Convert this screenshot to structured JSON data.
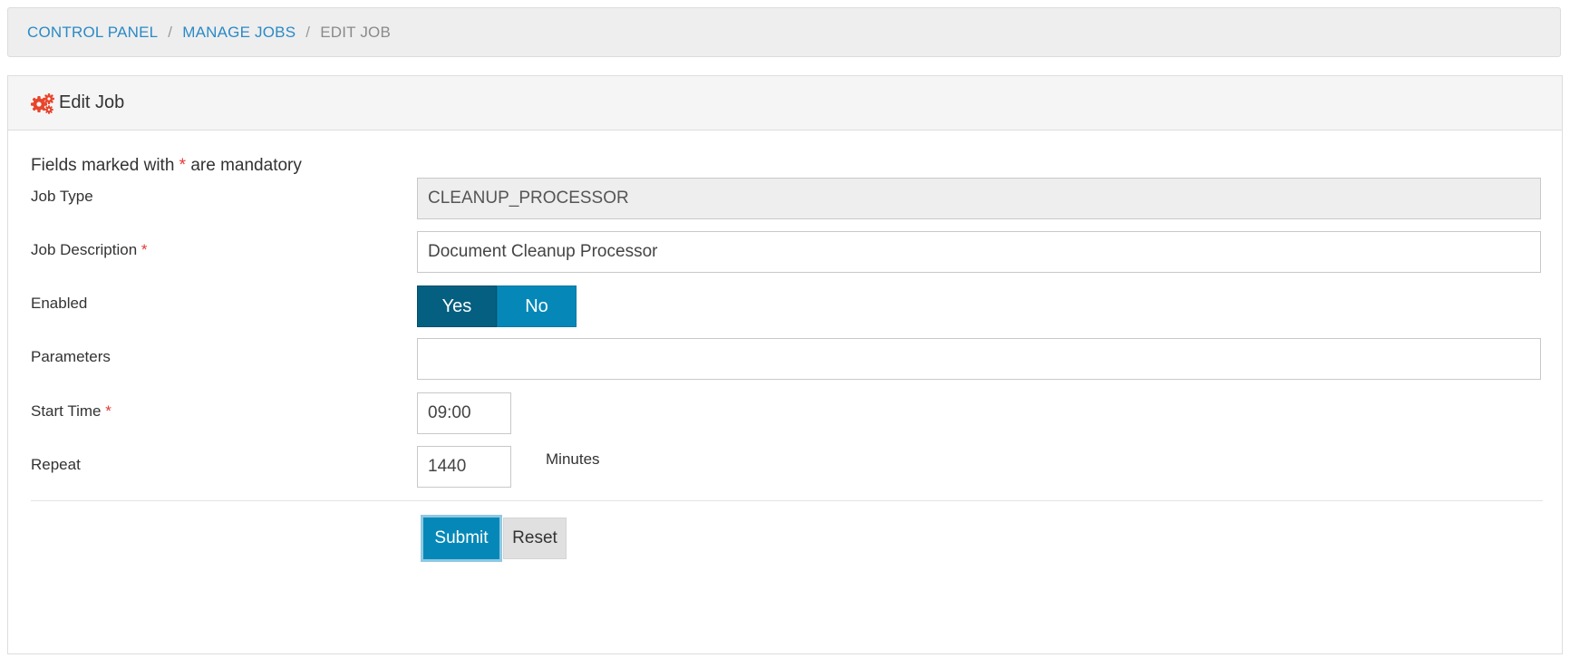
{
  "breadcrumb": {
    "items": [
      "CONTROL PANEL",
      "MANAGE JOBS",
      "EDIT JOB"
    ],
    "separator": "/"
  },
  "panel": {
    "title": "Edit Job",
    "icon": "gears-icon"
  },
  "form": {
    "note_prefix": "Fields marked with",
    "note_star": "*",
    "note_suffix": "are mandatory",
    "job_type": {
      "label": "Job Type",
      "value": "CLEANUP_PROCESSOR"
    },
    "job_description": {
      "label": "Job Description",
      "required": "*",
      "value": "Document Cleanup Processor"
    },
    "enabled": {
      "label": "Enabled",
      "yes": "Yes",
      "no": "No",
      "selected": "Yes"
    },
    "parameters": {
      "label": "Parameters",
      "value": ""
    },
    "start_time": {
      "label": "Start Time",
      "required": "*",
      "value": "09:00"
    },
    "repeat": {
      "label": "Repeat",
      "value": "1440",
      "unit": "Minutes"
    },
    "submit_label": "Submit",
    "reset_label": "Reset"
  },
  "colors": {
    "accent": "#0588b8",
    "accent_dark": "#055f80",
    "link": "#2b8ac6",
    "required": "#e53935",
    "icon": "#e8452c"
  }
}
